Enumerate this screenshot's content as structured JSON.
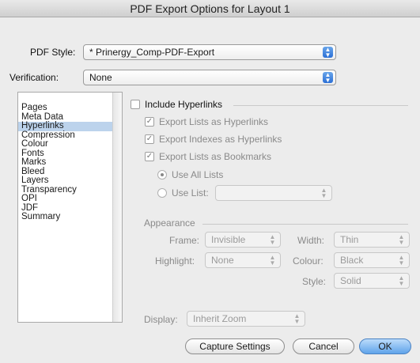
{
  "window": {
    "title": "PDF Export Options for Layout 1"
  },
  "top": {
    "pdf_style_label": "PDF Style:",
    "pdf_style_value": "* Prinergy_Comp-PDF-Export",
    "verification_label": "Verification:",
    "verification_value": "None"
  },
  "sidebar": {
    "items": [
      {
        "label": "Pages"
      },
      {
        "label": "Meta Data"
      },
      {
        "label": "Hyperlinks"
      },
      {
        "label": "Compression"
      },
      {
        "label": "Colour"
      },
      {
        "label": "Fonts"
      },
      {
        "label": "Marks"
      },
      {
        "label": "Bleed"
      },
      {
        "label": "Layers"
      },
      {
        "label": "Transparency"
      },
      {
        "label": "OPI"
      },
      {
        "label": "JDF"
      },
      {
        "label": "Summary"
      }
    ],
    "selected": "Hyperlinks"
  },
  "hyperlinks": {
    "include_label": "Include Hyperlinks",
    "export_lists_hyperlinks": "Export Lists as Hyperlinks",
    "export_indexes_hyperlinks": "Export Indexes as Hyperlinks",
    "export_lists_bookmarks": "Export Lists as Bookmarks",
    "use_all_lists": "Use All Lists",
    "use_list": "Use List:"
  },
  "appearance": {
    "heading": "Appearance",
    "frame_label": "Frame:",
    "frame_value": "Invisible",
    "width_label": "Width:",
    "width_value": "Thin",
    "highlight_label": "Highlight:",
    "highlight_value": "None",
    "colour_label": "Colour:",
    "colour_value": "Black",
    "style_label": "Style:",
    "style_value": "Solid"
  },
  "display": {
    "label": "Display:",
    "value": "Inherit Zoom"
  },
  "buttons": {
    "capture": "Capture Settings",
    "cancel": "Cancel",
    "ok": "OK"
  },
  "colors": {
    "accent": "#4a90e2",
    "selection": "#bcd3ec"
  }
}
